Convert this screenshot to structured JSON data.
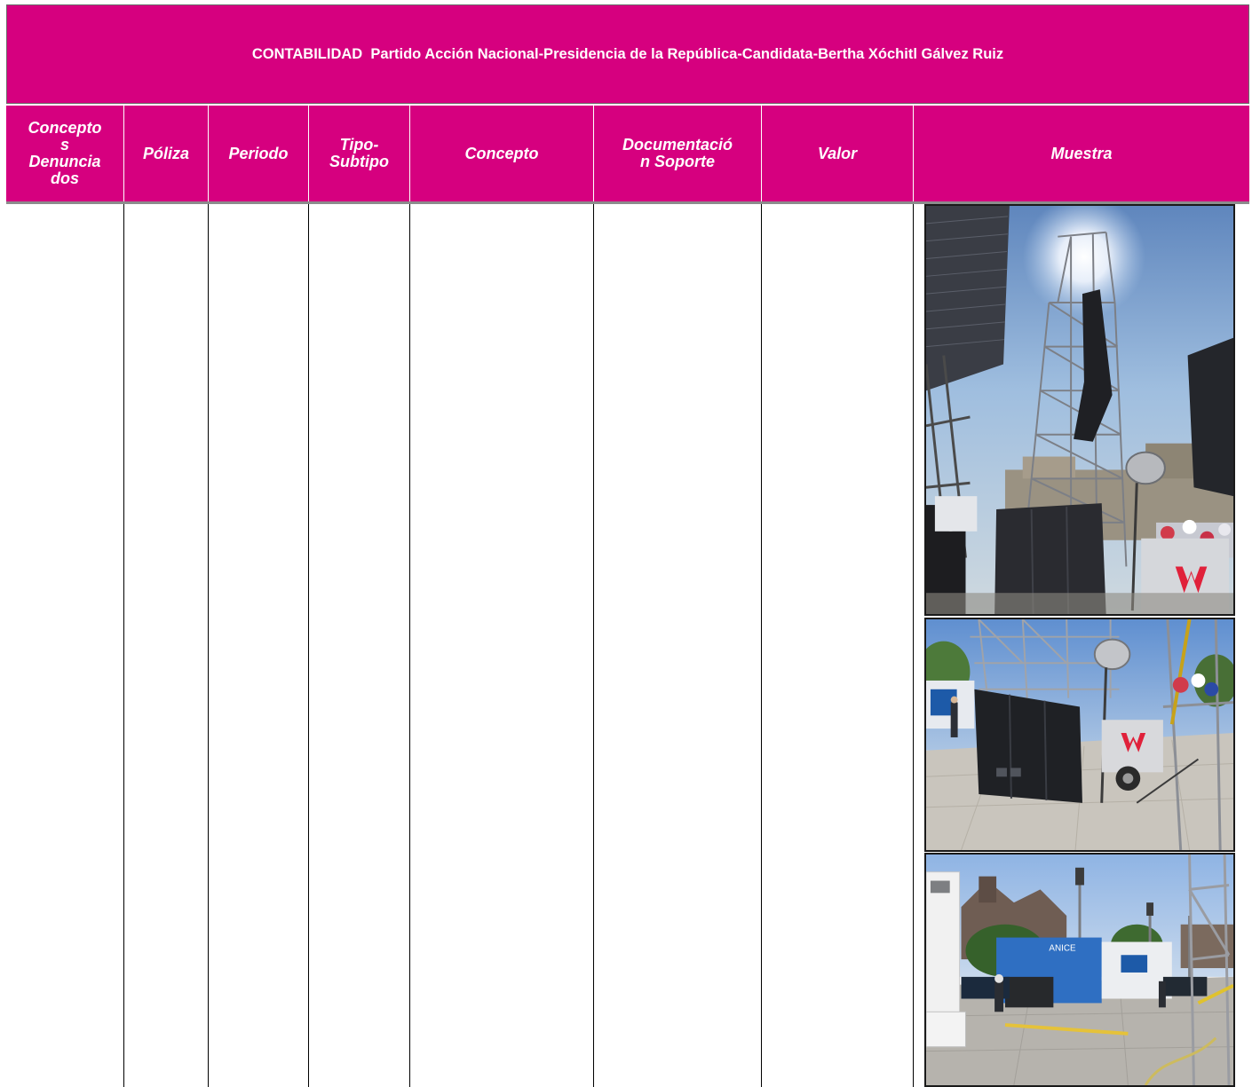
{
  "title": "CONTABILIDAD  Partido Acción Nacional-Presidencia de la República-Candidata-Bertha Xóchitl Gálvez Ruiz",
  "columns": [
    {
      "key": "conceptos_denunciados",
      "label": "Conceptos Denunciados",
      "lines": [
        "Concepto",
        "s",
        "Denuncia",
        "dos"
      ]
    },
    {
      "key": "poliza",
      "label": "Póliza",
      "lines": [
        "Póliza"
      ]
    },
    {
      "key": "periodo",
      "label": "Periodo",
      "lines": [
        "Periodo"
      ]
    },
    {
      "key": "tipo_subtipo",
      "label": "Tipo-Subtipo",
      "lines": [
        "Tipo-",
        "Subtipo"
      ]
    },
    {
      "key": "concepto",
      "label": "Concepto",
      "lines": [
        "Concepto"
      ]
    },
    {
      "key": "documentacion_soporte",
      "label": "Documentación Soporte",
      "lines": [
        "Documentació",
        "n Soporte"
      ]
    },
    {
      "key": "valor",
      "label": "Valor",
      "lines": [
        "Valor"
      ]
    },
    {
      "key": "muestra",
      "label": "Muestra",
      "lines": [
        "Muestra"
      ]
    }
  ],
  "row": {
    "conceptos_denunciados": "",
    "poliza": "",
    "periodo": "",
    "tipo_subtipo": "",
    "concepto": "",
    "documentacion_soporte": "",
    "valor": "",
    "muestra": [
      {
        "name": "photo-stage-truss-speaker-tower"
      },
      {
        "name": "photo-speaker-stack-light-tower"
      },
      {
        "name": "photo-production-trucks-plaza"
      }
    ]
  },
  "photo_signage": [
    "ANICE"
  ],
  "colors": {
    "header_bg": "#d6007f",
    "header_text": "#ffffff",
    "grid": "#000000"
  }
}
